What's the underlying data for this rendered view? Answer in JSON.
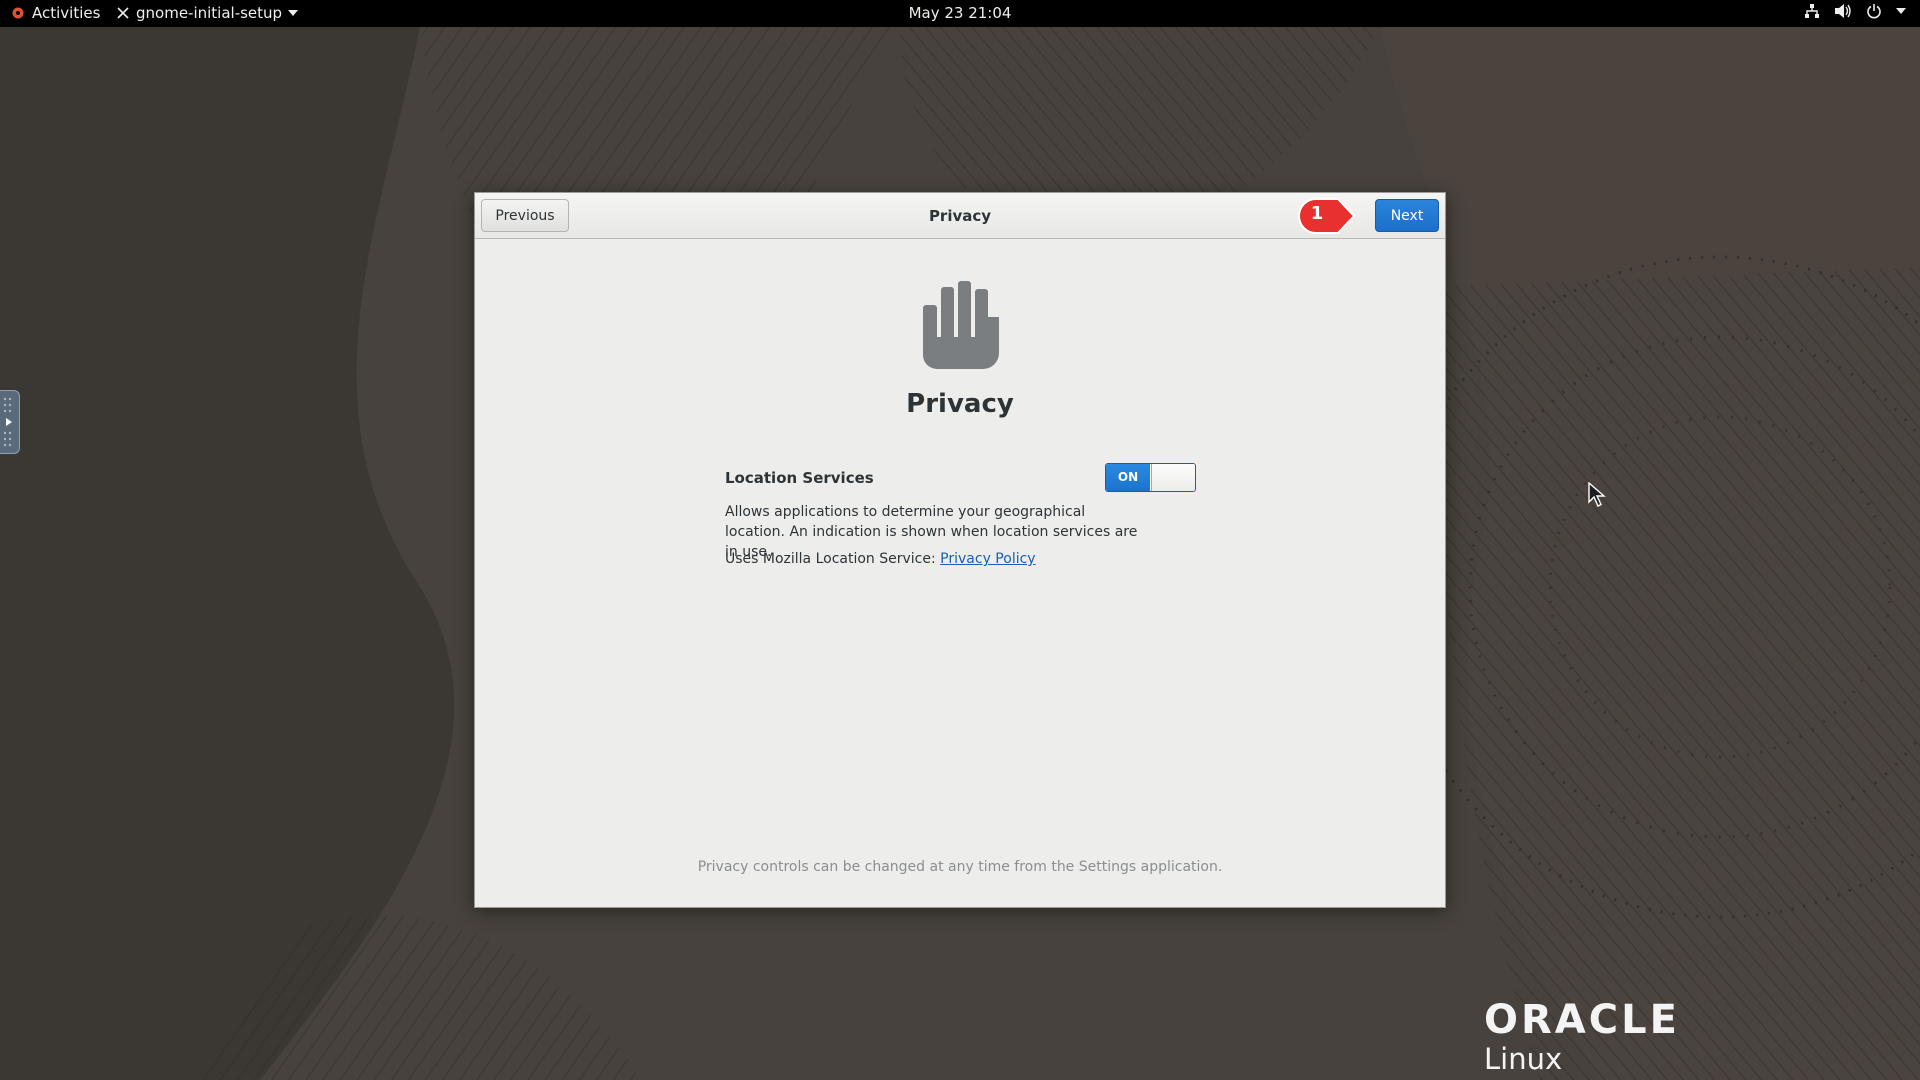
{
  "topbar": {
    "activities": "Activities",
    "app_name": "gnome-initial-setup",
    "clock": "May 23  21:04",
    "icons": [
      "network-icon",
      "volume-icon",
      "power-icon",
      "menu-arrow-icon"
    ]
  },
  "dialog": {
    "header_title": "Privacy",
    "previous_label": "Previous",
    "next_label": "Next",
    "callout_number": "1",
    "icon": "hand-stop-icon",
    "page_title": "Privacy",
    "location_label": "Location Services",
    "toggle_state": "ON",
    "description": "Allows applications to determine your geographical location. An indication is shown when location services are in use.",
    "uses_text": "Uses Mozilla Location Service: ",
    "policy_link": "Privacy Policy",
    "footer": "Privacy controls can be changed at any time from the Settings application."
  },
  "branding": {
    "logo_word": "ORACLE",
    "logo_sub": "Linux"
  },
  "colors": {
    "accent": "#1c6fc9",
    "callout": "#e8312f",
    "topbar": "#000000"
  }
}
